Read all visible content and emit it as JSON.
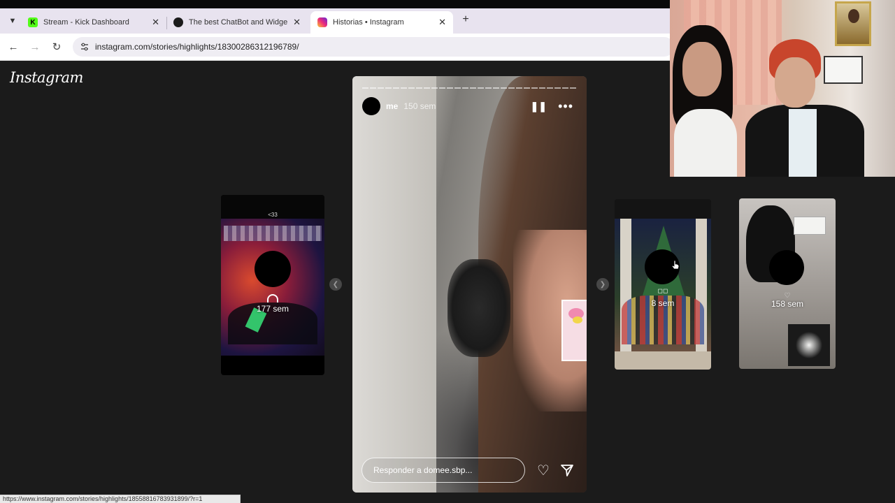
{
  "browser": {
    "tabs": [
      {
        "title": "Stream - Kick Dashboard",
        "favicon_color": "#53fc18",
        "active": false
      },
      {
        "title": "The best ChatBot and Widgets",
        "favicon_color": "#1b1b1b",
        "active": false
      },
      {
        "title": "Historias • Instagram",
        "favicon_color": "#d6249f",
        "active": true
      }
    ],
    "new_tab_icon": "+",
    "url": "instagram.com/stories/highlights/18300286312196789/",
    "status_url": "https://www.instagram.com/stories/highlights/18558816783931899/?r=1"
  },
  "instagram": {
    "logo": "Instagram",
    "main_story": {
      "username": "me",
      "time": "150 sem",
      "reply_placeholder": "Responder a domee.sbp...",
      "colors": {
        "accent": "#ffffff"
      }
    },
    "left_card": {
      "label": "177 sem",
      "caption": "<33"
    },
    "right_cards": [
      {
        "label": "8 sem"
      },
      {
        "label": "158 sem"
      }
    ]
  }
}
